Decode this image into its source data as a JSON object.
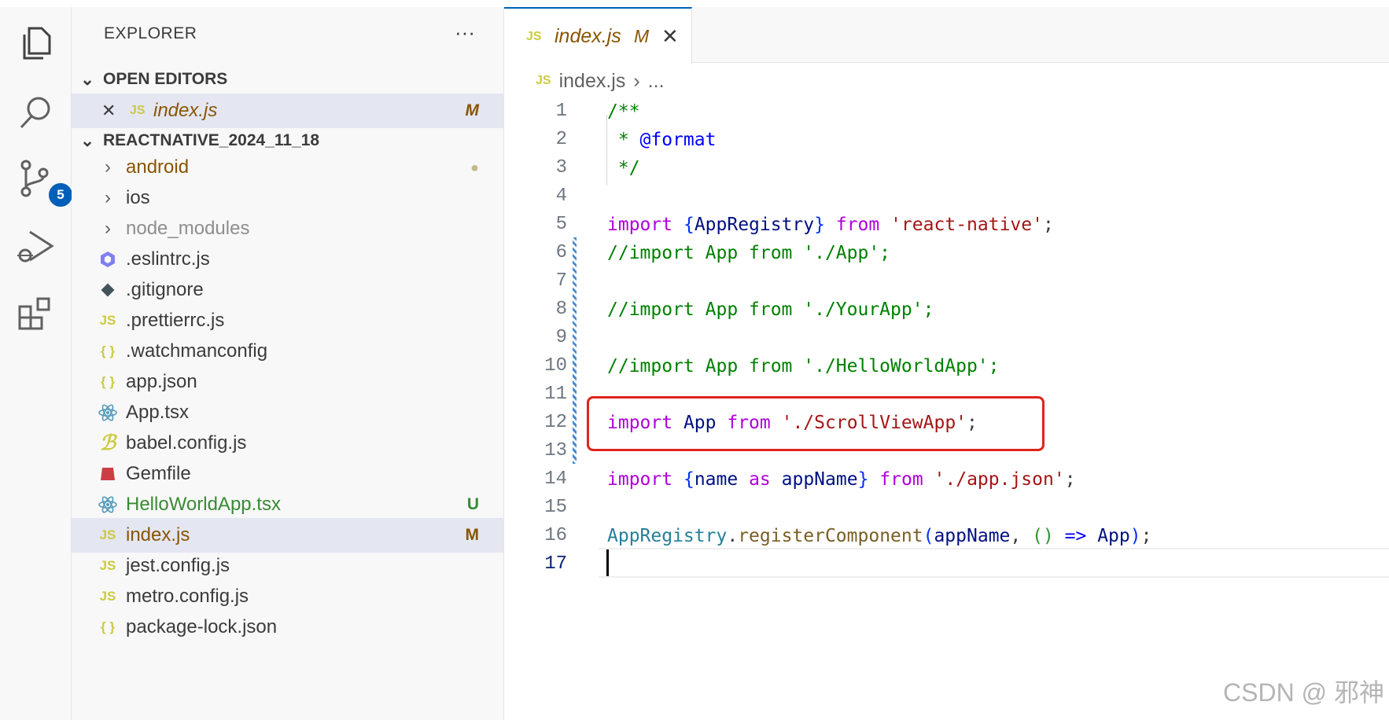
{
  "activity_bar": {
    "items": [
      {
        "icon": "files-icon"
      },
      {
        "icon": "search-icon"
      },
      {
        "icon": "source-control-icon",
        "badge": "5"
      },
      {
        "icon": "run-debug-icon"
      },
      {
        "icon": "extensions-icon"
      }
    ]
  },
  "explorer": {
    "title": "EXPLORER",
    "more": "···",
    "open_editors": {
      "label": "OPEN EDITORS",
      "items": [
        {
          "icon": "JS",
          "name": "index.js",
          "flag": "M"
        }
      ]
    },
    "project": {
      "label": "REACTNATIVE_2024_11_18",
      "items": [
        {
          "name": "android",
          "type": "folder",
          "flag": "●"
        },
        {
          "name": "ios",
          "type": "folder"
        },
        {
          "name": "node_modules",
          "type": "folder"
        },
        {
          "name": ".eslintrc.js",
          "icon": "eslint-icon"
        },
        {
          "name": ".gitignore",
          "icon": "git-icon"
        },
        {
          "name": ".prettierrc.js",
          "icon": "JS"
        },
        {
          "name": ".watchmanconfig",
          "icon": "{ }"
        },
        {
          "name": "app.json",
          "icon": "{ }"
        },
        {
          "name": "App.tsx",
          "icon": "react-icon"
        },
        {
          "name": "babel.config.js",
          "icon": "babel-icon"
        },
        {
          "name": "Gemfile",
          "icon": "ruby-icon"
        },
        {
          "name": "HelloWorldApp.tsx",
          "icon": "react-icon",
          "flag": "U"
        },
        {
          "name": "index.js",
          "icon": "JS",
          "flag": "M"
        },
        {
          "name": "jest.config.js",
          "icon": "JS"
        },
        {
          "name": "metro.config.js",
          "icon": "JS"
        },
        {
          "name": "package-lock.json",
          "icon": "{ }"
        }
      ]
    }
  },
  "editor": {
    "tab": {
      "icon": "JS",
      "name": "index.js",
      "flag": "M",
      "close": "✕"
    },
    "breadcrumb": {
      "icon": "JS",
      "file": "index.js",
      "sep": "›",
      "rest": "..."
    },
    "line_numbers": [
      "1",
      "2",
      "3",
      "4",
      "5",
      "6",
      "7",
      "8",
      "9",
      "10",
      "11",
      "12",
      "13",
      "14",
      "15",
      "16",
      "17"
    ],
    "active_line": "17",
    "code": {
      "l1": "/**",
      "l2_star": " * ",
      "l2_tag": "@format",
      "l3": " */",
      "l5_import": "import",
      "l5_brace_open": "{",
      "l5_name": "AppRegistry",
      "l5_brace_close": "}",
      "l5_from": "from",
      "l5_str": "'react-native'",
      "l5_semi": ";",
      "l6": "//import App from './App';",
      "l8": "//import App from './YourApp';",
      "l10": "//import App from './HelloWorldApp';",
      "l12_import": "import",
      "l12_name": "App",
      "l12_from": "from",
      "l12_str": "'./ScrollViewApp'",
      "l12_semi": ";",
      "l14_import": "import",
      "l14_open": "{",
      "l14_name": "name",
      "l14_as": "as",
      "l14_alias": "appName",
      "l14_close": "}",
      "l14_from": "from",
      "l14_str": "'./app.json'",
      "l14_semi": ";",
      "l16_cls": "AppRegistry",
      "l16_dot": ".",
      "l16_fn": "registerComponent",
      "l16_open": "(",
      "l16_arg": "appName",
      "l16_comma": ", ",
      "l16_parens": "()",
      "l16_arrow": " => ",
      "l16_app": "App",
      "l16_close": ")",
      "l16_semi": ";"
    }
  },
  "watermark": "CSDN @ 邪神"
}
